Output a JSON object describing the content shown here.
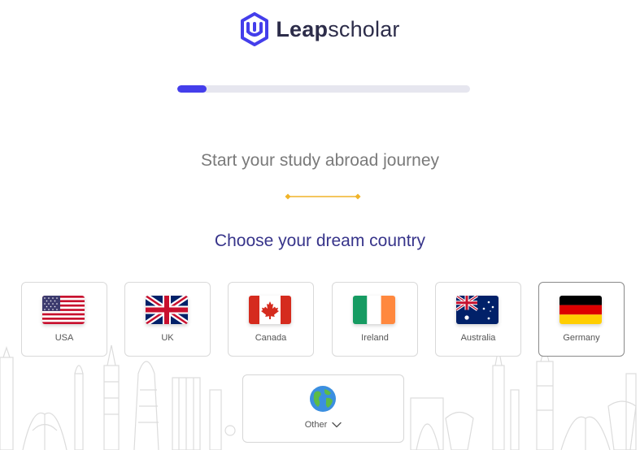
{
  "brand": {
    "name_bold": "Leap",
    "name_light": "scholar",
    "accent": "#443eeb"
  },
  "progress": {
    "value_percent": 10
  },
  "intro": {
    "subtitle": "Start your study abroad journey"
  },
  "question": {
    "heading": "Choose your dream country"
  },
  "countries": [
    {
      "label": "USA",
      "flag_icon": "usa-flag-icon",
      "selected": false
    },
    {
      "label": "UK",
      "flag_icon": "uk-flag-icon",
      "selected": false
    },
    {
      "label": "Canada",
      "flag_icon": "canada-flag-icon",
      "selected": false
    },
    {
      "label": "Ireland",
      "flag_icon": "ireland-flag-icon",
      "selected": false
    },
    {
      "label": "Australia",
      "flag_icon": "australia-flag-icon",
      "selected": false
    },
    {
      "label": "Germany",
      "flag_icon": "germany-flag-icon",
      "selected": true
    }
  ],
  "other_option": {
    "label": "Other",
    "icon": "globe-icon",
    "dropdown_icon": "chevron-down-icon"
  },
  "colors": {
    "heading": "#37348a",
    "divider": "#f0b429",
    "progress_track": "#e6e6ef"
  }
}
